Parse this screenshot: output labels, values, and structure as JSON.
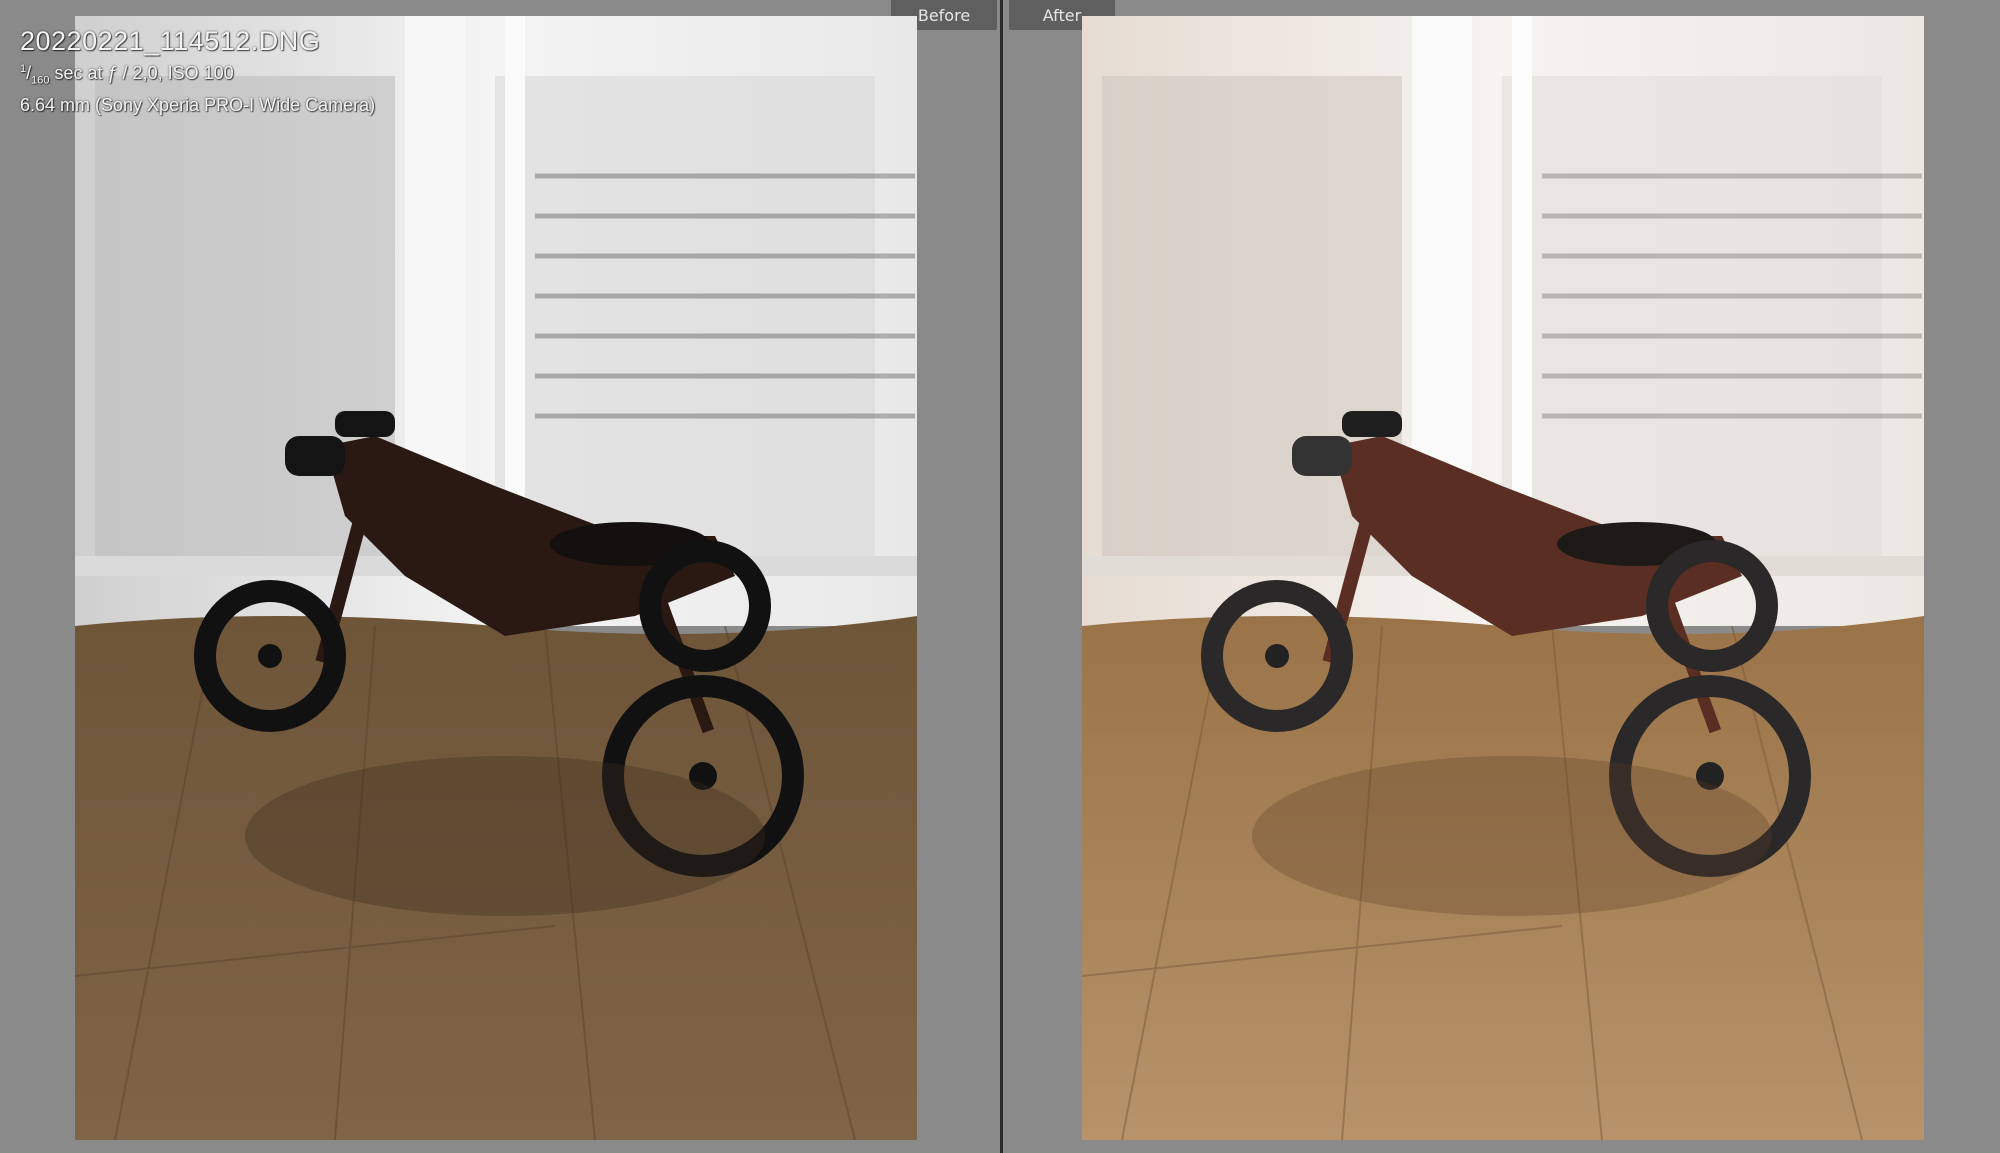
{
  "labels": {
    "before": "Before",
    "after": "After"
  },
  "info": {
    "filename": "20220221_114512.DNG",
    "shutter_numerator": "1",
    "shutter_denominator": "160",
    "exposure_rest": "sec at ƒ / 2,0, ISO 100",
    "lens": "6.64 mm (Sony Xperia PRO-I Wide Camera)"
  },
  "colors": {
    "background": "#8a8a8a",
    "divider": "#2b2b2b",
    "label_tab": "#5f5f5f",
    "floor_before": "#7a6040",
    "floor_after": "#a88255",
    "bike_before": "#2a1813",
    "bike_after": "#5a2e22"
  }
}
